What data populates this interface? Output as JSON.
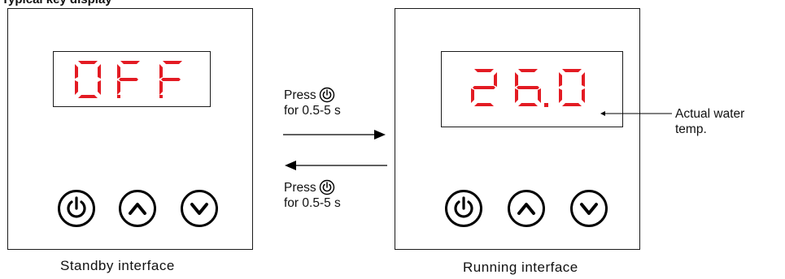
{
  "heading_partial": "Typical key display",
  "standby": {
    "display_text": "0FF",
    "caption": "Standby interface"
  },
  "running": {
    "display_text": "26.0",
    "caption": "Running interface"
  },
  "transition_forward": {
    "line1": "Press",
    "line2": "for 0.5-5 s"
  },
  "transition_back": {
    "line1": "Press",
    "line2": "for 0.5-5 s"
  },
  "annotation": {
    "line1": "Actual water",
    "line2": "temp."
  },
  "colors": {
    "segment": "#e31b23",
    "outline": "#1a1a1a"
  },
  "icons": [
    "power-icon",
    "up-icon",
    "down-icon"
  ]
}
